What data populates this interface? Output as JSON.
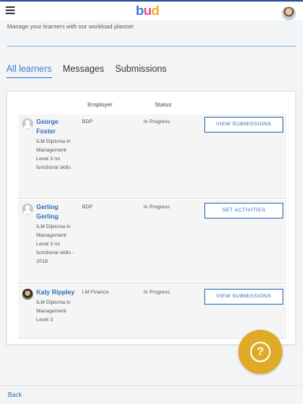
{
  "header": {
    "logo_text": [
      "b",
      "u",
      "d"
    ],
    "subtitle": "Manage your learners with our workload planner"
  },
  "tabs": [
    {
      "label": "All learners",
      "active": true
    },
    {
      "label": "Messages",
      "active": false
    },
    {
      "label": "Submissions",
      "active": false
    }
  ],
  "table": {
    "columns": {
      "employer": "Employer",
      "status": "Status"
    },
    "rows": [
      {
        "name": "George Foster",
        "course": "ILM Diploma in Management Level 3 no functional skills",
        "employer": "BDP",
        "status": "In Progress",
        "action": "VIEW SUBMISSIONS",
        "avatar": "default-user-icon"
      },
      {
        "name": "Gerling Gerling",
        "course": "ILM Diploma in Management Level 3 no functional skills - 2018",
        "employer": "BDP",
        "status": "In Progress",
        "action": "SET ACTIVITIES",
        "avatar": "default-user-icon"
      },
      {
        "name": "Katy Rippley",
        "course": "ILM Diploma in Management Level 3",
        "employer": "LM Finance",
        "status": "In Progress",
        "action": "VIEW SUBMISSIONS",
        "avatar": "user-photo"
      }
    ]
  },
  "help": {
    "icon": "question-mark-icon",
    "glyph": "?"
  },
  "footer": {
    "back_label": "Back"
  },
  "colors": {
    "accent": "#2a6fb8",
    "help": "#deaa27",
    "logo_b": "#3a7bd5",
    "logo_u": "#e84393",
    "logo_d": "#f5a623"
  }
}
